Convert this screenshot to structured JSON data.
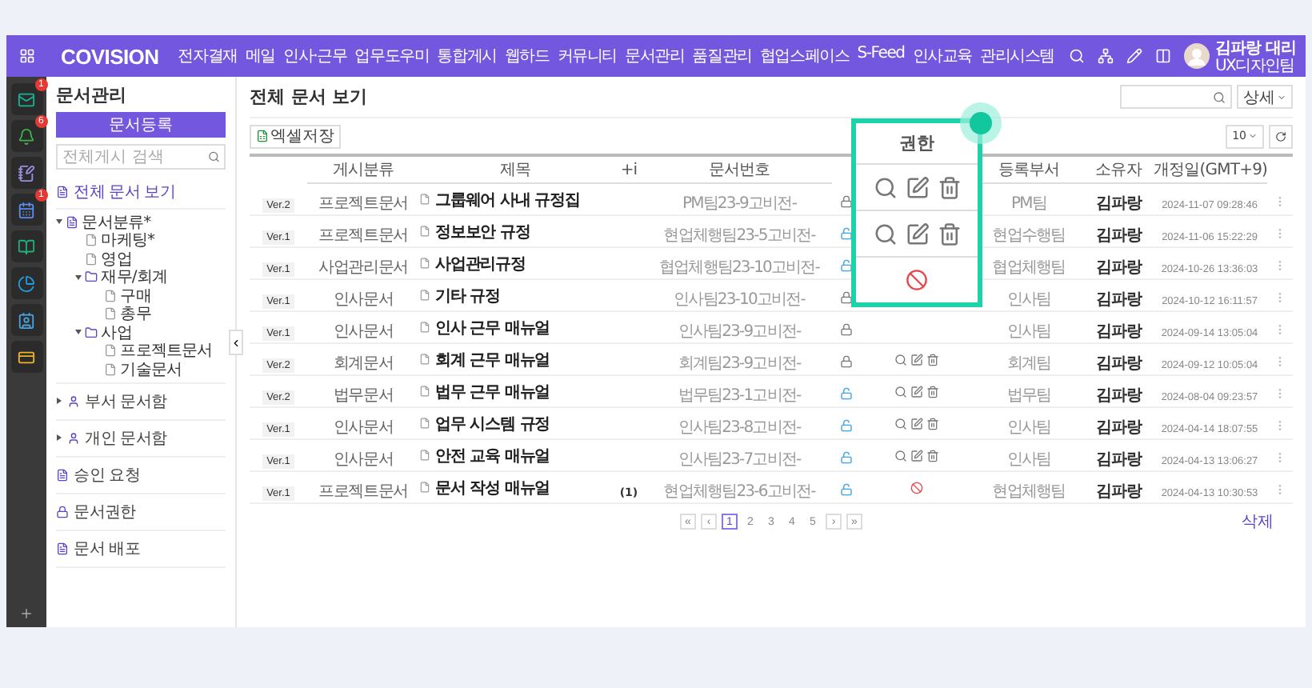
{
  "topbar": {
    "logo": "COVISION",
    "menu": [
      "전자결재",
      "메일",
      "인사·근무",
      "업무도우미",
      "통합게시",
      "웹하드",
      "커뮤니티",
      "문서관리",
      "품질관리",
      "협업스페이스",
      "S-Feed",
      "인사교육",
      "관리시스템"
    ],
    "user": {
      "name": "김파랑 대리",
      "team": "UX디자인팀"
    }
  },
  "rail": [
    {
      "kind": "mail",
      "badge": "1"
    },
    {
      "kind": "bell",
      "badge": "6"
    },
    {
      "kind": "note"
    },
    {
      "kind": "calendar",
      "badge": "1"
    },
    {
      "kind": "book"
    },
    {
      "kind": "pie"
    },
    {
      "kind": "contacts"
    },
    {
      "kind": "card"
    }
  ],
  "sidebar": {
    "title": "문서관리",
    "button": "문서등록",
    "search": {
      "placeholder": "전체게시 검색"
    },
    "current": {
      "label": "전체 문서 보기",
      "selected": true
    },
    "tree": {
      "label": "문서분류*",
      "expanded": true,
      "children": [
        {
          "label": "마케팅*"
        },
        {
          "label": "영업"
        },
        {
          "label": "재무/회계",
          "expanded": true,
          "children": [
            {
              "label": "구매"
            },
            {
              "label": "총무"
            }
          ]
        },
        {
          "label": "사업",
          "expanded": true,
          "children": [
            {
              "label": "프로젝트문서"
            },
            {
              "label": "기술문서"
            }
          ]
        }
      ]
    },
    "sections": [
      {
        "kind": "group",
        "label": "부서 문서함"
      },
      {
        "kind": "group",
        "label": "개인 문서함"
      },
      {
        "kind": "doc",
        "label": "승인 요청"
      },
      {
        "kind": "lock",
        "label": "문서권한"
      },
      {
        "kind": "doc",
        "label": "문서 배포"
      }
    ]
  },
  "main": {
    "title": "전체 문서 보기",
    "detail_button": "상세",
    "excel_button": "엑셀저장",
    "page_size": "10",
    "columns": [
      "게시분류",
      "제목",
      "+i",
      "문서번호",
      "등록부서",
      "소유자",
      "개정일(GMT+9)"
    ],
    "rows": [
      {
        "version": "Ver.2",
        "category": "프로젝트문서",
        "title": "그룹웨어 사내 규정집",
        "doc_no": "PM팀23-9고비전-",
        "locked": true,
        "dept": "PM팀",
        "owner": "김파랑",
        "date": "2024-11-07 09:28:46"
      },
      {
        "version": "Ver.1",
        "category": "프로젝트문서",
        "title": "정보보안 규정",
        "doc_no": "현업체행팀23-5고비전-",
        "locked": false,
        "dept": "현업수행팀",
        "owner": "김파랑",
        "date": "2024-11-06 15:22:29"
      },
      {
        "version": "Ver.1",
        "category": "사업관리문서",
        "title": "사업관리규정",
        "doc_no": "협업체행팀23-10고비전-",
        "locked": false,
        "dept": "협업체행팀",
        "owner": "김파랑",
        "date": "2024-10-26 13:36:03"
      },
      {
        "version": "Ver.1",
        "category": "인사문서",
        "title": "기타 규정",
        "doc_no": "인사팀23-10고비전-",
        "locked": true,
        "dept": "인사팀",
        "owner": "김파랑",
        "date": "2024-10-12 16:11:57"
      },
      {
        "version": "Ver.1",
        "category": "인사문서",
        "title": "인사 근무 매뉴얼",
        "doc_no": "인사팀23-9고비전-",
        "locked": true,
        "dept": "인사팀",
        "owner": "김파랑",
        "date": "2024-09-14 13:05:04"
      },
      {
        "version": "Ver.2",
        "category": "회계문서",
        "title": "회계 근무 매뉴얼",
        "doc_no": "회계팀23-9고비전-",
        "locked": true,
        "permission": {
          "kind": "edit"
        },
        "dept": "회계팀",
        "owner": "김파랑",
        "date": "2024-09-12 10:05:04"
      },
      {
        "version": "Ver.2",
        "category": "법무문서",
        "title": "법무 근무 매뉴얼",
        "doc_no": "법무팀23-1고비전-",
        "locked": false,
        "permission": {
          "kind": "edit"
        },
        "dept": "법무팀",
        "owner": "김파랑",
        "date": "2024-08-04 09:23:57"
      },
      {
        "version": "Ver.1",
        "category": "인사문서",
        "title": "업무 시스템 규정",
        "doc_no": "인사팀23-8고비전-",
        "locked": false,
        "permission": {
          "kind": "edit"
        },
        "dept": "인사팀",
        "owner": "김파랑",
        "date": "2024-04-14 18:07:55"
      },
      {
        "version": "Ver.1",
        "category": "인사문서",
        "title": "안전 교육 매뉴얼",
        "doc_no": "인사팀23-7고비전-",
        "locked": false,
        "permission": {
          "kind": "edit"
        },
        "dept": "인사팀",
        "owner": "김파랑",
        "date": "2024-04-13 13:06:27"
      },
      {
        "version": "Ver.1",
        "category": "프로젝트문서",
        "title": "문서 작성 매뉴얼",
        "count": "(1)",
        "doc_no": "현업체행팀23-6고비전-",
        "locked": false,
        "permission": {
          "kind": "denied"
        },
        "dept": "현업체행팀",
        "owner": "김파랑",
        "date": "2024-04-13 10:30:53"
      }
    ],
    "pagination": {
      "first": "«",
      "prev": "‹",
      "pages": [
        {
          "label": "1",
          "selected": true
        },
        {
          "label": "2",
          "selected": false
        },
        {
          "label": "3",
          "selected": false
        },
        {
          "label": "4",
          "selected": false
        },
        {
          "label": "5",
          "selected": false
        }
      ],
      "next": "›",
      "last": "»"
    },
    "delete_link": "삭제"
  },
  "callout": {
    "header": "권한",
    "rows": [
      {
        "kind": "edit"
      },
      {
        "kind": "edit"
      },
      {
        "kind": "denied"
      }
    ]
  }
}
